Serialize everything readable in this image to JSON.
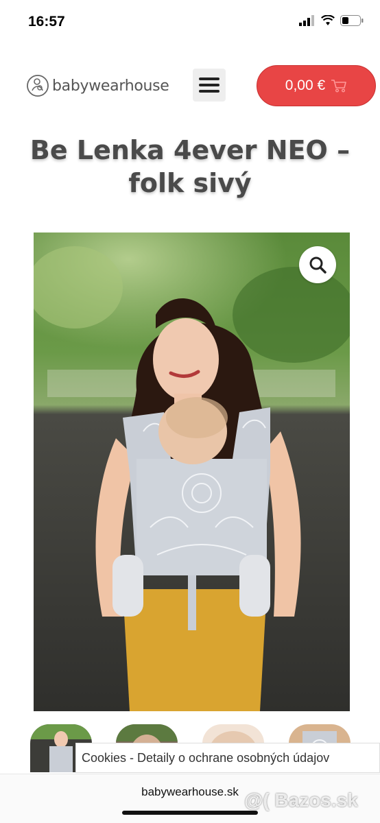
{
  "status": {
    "time": "16:57"
  },
  "header": {
    "logo_text": "babywearhouse",
    "cart_label": "0,00 €"
  },
  "product": {
    "title_line1": "Be Lenka 4ever NEO –",
    "title_line2": "folk sivý"
  },
  "cookie": {
    "text": "Cookies - Detaily o ochrane osobných údajov"
  },
  "browser": {
    "url": "babywearhouse.sk"
  },
  "watermark": {
    "text": "@( Bazos.sk"
  },
  "colors": {
    "cart": "#e84545",
    "menu_bg": "#eeeeee"
  }
}
